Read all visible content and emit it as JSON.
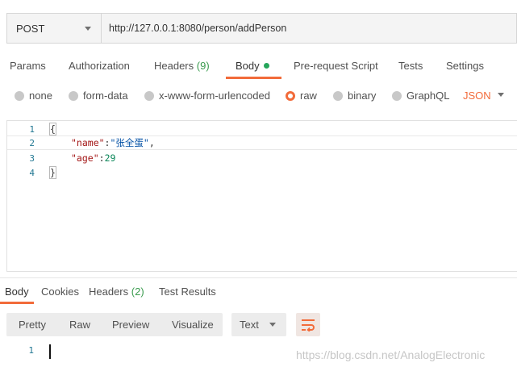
{
  "request": {
    "method": "POST",
    "url": "http://127.0.0.1:8080/person/addPerson"
  },
  "request_tabs": [
    {
      "label": "Params"
    },
    {
      "label": "Authorization"
    },
    {
      "label": "Headers",
      "count": "(9)"
    },
    {
      "label": "Body",
      "active": true
    },
    {
      "label": "Pre-request Script"
    },
    {
      "label": "Tests"
    },
    {
      "label": "Settings"
    }
  ],
  "body_types": {
    "options": [
      "none",
      "form-data",
      "x-www-form-urlencoded",
      "raw",
      "binary",
      "GraphQL"
    ],
    "selected": "raw",
    "format": "JSON"
  },
  "editor": {
    "line_numbers": [
      "1",
      "2",
      "3",
      "4"
    ],
    "open_brace": "{",
    "name_key": "\"name\"",
    "name_value": "\"张全蛋\"",
    "age_key": "\"age\"",
    "age_value": "29",
    "close_brace": "}"
  },
  "response_tabs": [
    {
      "label": "Body",
      "active": true
    },
    {
      "label": "Cookies"
    },
    {
      "label": "Headers",
      "count": "(2)"
    },
    {
      "label": "Test Results"
    }
  ],
  "view_modes": [
    "Pretty",
    "Raw",
    "Preview",
    "Visualize"
  ],
  "response_format": "Text",
  "response_line_number": "1",
  "watermark": "https://blog.csdn.net/AnalogElectronic",
  "colors": {
    "accent": "#f26b3a",
    "active_dot": "#26a65b",
    "count": "#3a9b4e"
  },
  "icons": {
    "method_caret": "chevron-down-icon",
    "format_caret": "chevron-down-icon",
    "wrap": "wrap-lines-icon"
  }
}
